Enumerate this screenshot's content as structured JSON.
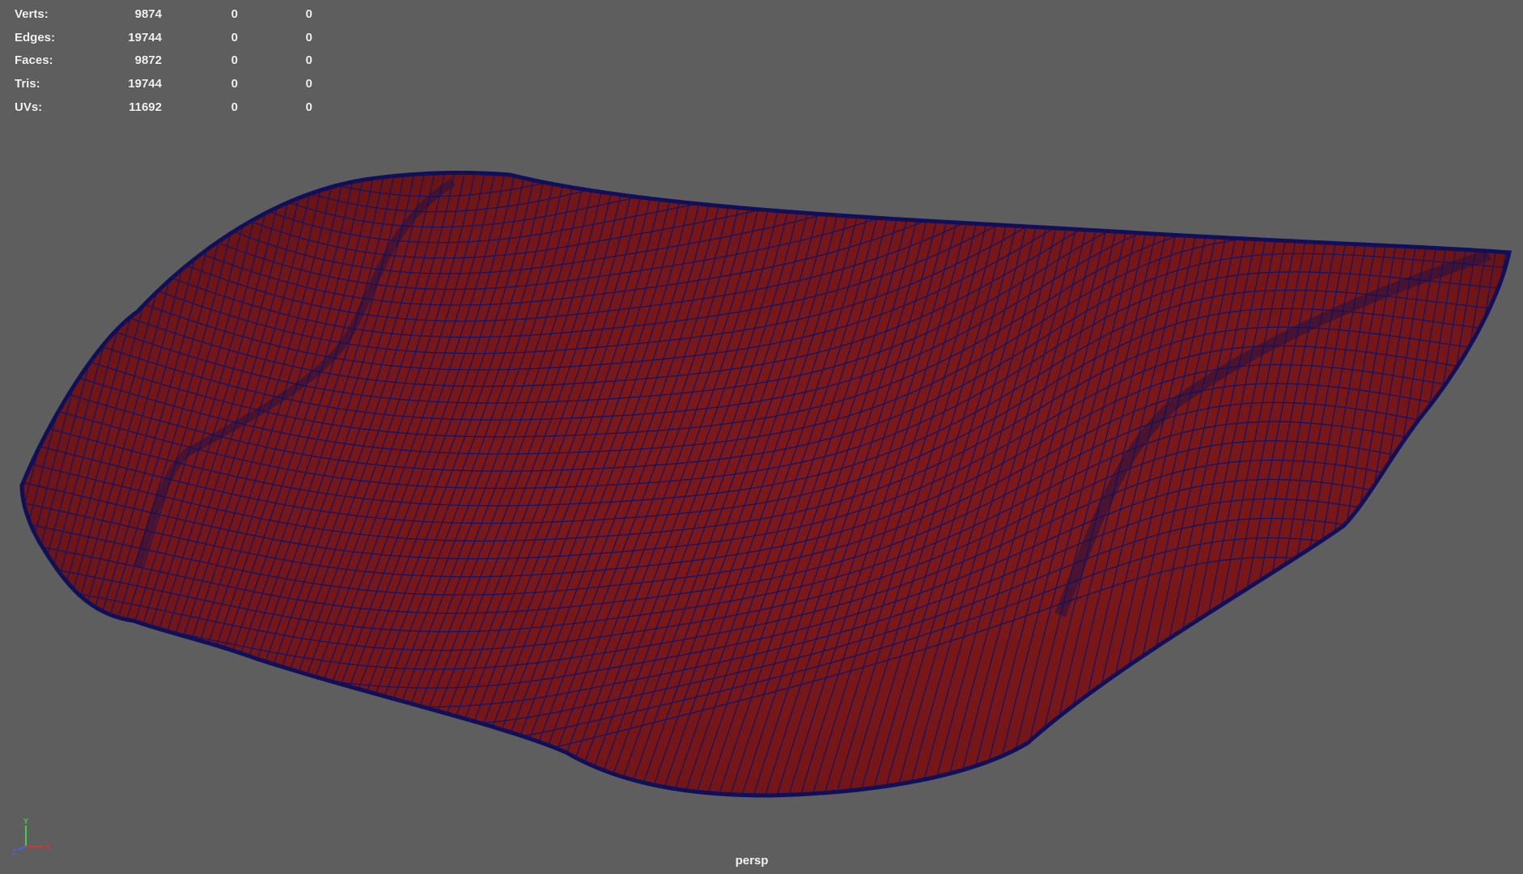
{
  "hud": {
    "rows": [
      {
        "label": "Verts:",
        "total": "9874",
        "selected": "0",
        "components": "0"
      },
      {
        "label": "Edges:",
        "total": "19744",
        "selected": "0",
        "components": "0"
      },
      {
        "label": "Faces:",
        "total": "9872",
        "selected": "0",
        "components": "0"
      },
      {
        "label": "Tris:",
        "total": "19744",
        "selected": "0",
        "components": "0"
      },
      {
        "label": "UVs:",
        "total": "11692",
        "selected": "0",
        "components": "0"
      }
    ]
  },
  "viewport": {
    "camera": "persp",
    "background_color": "#5e5e5e",
    "mesh_fill_color": "#7a1717",
    "wire_color": "#141466"
  },
  "axis": {
    "y": "Y",
    "x": "X",
    "z": "Z",
    "x_color": "#e03030",
    "y_color": "#40d040",
    "z_color": "#4060ff"
  }
}
